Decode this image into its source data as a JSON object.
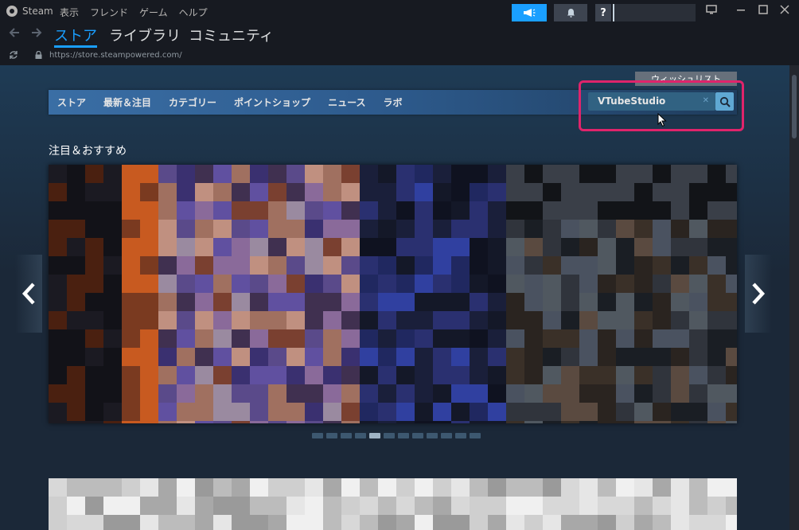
{
  "titlebar": {
    "app_name": "Steam",
    "menu": [
      "表示",
      "フレンド",
      "ゲーム",
      "ヘルプ"
    ],
    "help_label": "?"
  },
  "nav": {
    "tabs": [
      "ストア",
      "ライブラリ",
      "コミュニティ"
    ],
    "active_tab": "ストア"
  },
  "address": {
    "url": "https://store.steampowered.com/"
  },
  "store": {
    "wishlist_label": "ウィッシュリスト",
    "nav_items": [
      "ストア",
      "最新＆注目",
      "カテゴリー",
      "ポイントショップ",
      "ニュース",
      "ラボ"
    ],
    "search": {
      "value": "VTubeStudio"
    },
    "featured_title": "注目＆おすすめ",
    "carousel": {
      "slide_count": 12,
      "active_index": 4
    }
  },
  "colors": {
    "accent": "#1a9fff",
    "highlight_box": "#e0246b",
    "store_nav": "#3a6ea5"
  },
  "icons": {
    "announce": "megaphone-icon",
    "bell": "bell-icon",
    "search": "magnifier-icon"
  }
}
